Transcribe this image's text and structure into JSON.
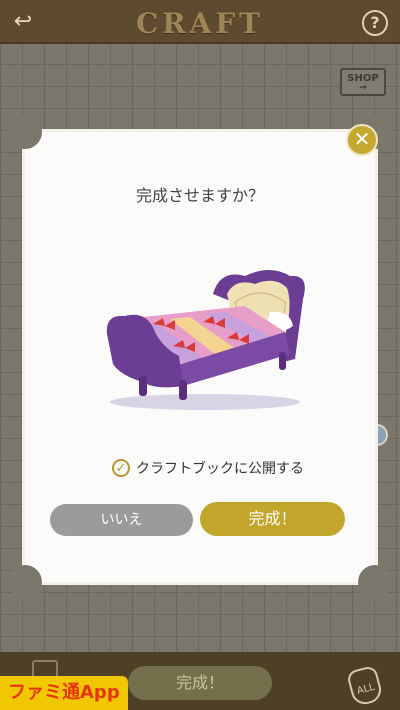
{
  "header": {
    "back_icon": "back-arrow-icon",
    "title": "CRAFT",
    "help_label": "?"
  },
  "shop": {
    "label": "SHOP",
    "arrow": "→"
  },
  "dialog": {
    "question": "完成させますか？",
    "close_label": "✕",
    "item_image": "purple-bed-image",
    "publish_checked": true,
    "publish_check_glyph": "✓",
    "publish_label": "クラフトブックに公開する",
    "no_label": "いいえ",
    "yes_label": "完成！"
  },
  "bottom": {
    "complete_label": "完成！",
    "all_label": "ALL",
    "book_icon": "book-icon"
  },
  "watermark": "ファミ通App",
  "colors": {
    "accent_gold": "#c2a62c",
    "button_gray": "#9b9b9b",
    "header_brown": "#5e4a2f",
    "bed_purple": "#7a4aa0"
  }
}
